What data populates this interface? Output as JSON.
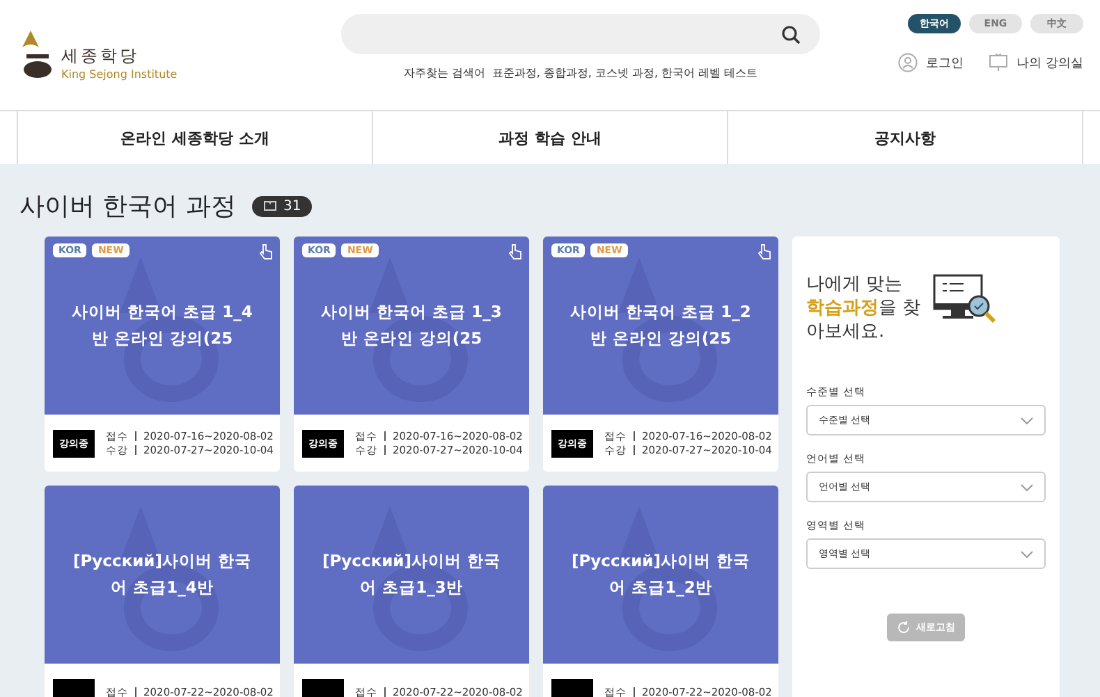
{
  "header": {
    "logo": {
      "korean": "세종학당",
      "english": "King Sejong Institute"
    },
    "popular": {
      "label": "자주찾는 검색어",
      "items": "표준과정, 종합과정, 코스넷 과정, 한국어 레벨 테스트"
    },
    "languages": [
      {
        "label": "한국어",
        "selected": true
      },
      {
        "label": "ENG",
        "selected": false
      },
      {
        "label": "中文",
        "selected": false
      }
    ],
    "user_links": [
      {
        "kind": "person",
        "label": "로그인"
      },
      {
        "kind": "board",
        "label": "나의 강의실"
      }
    ]
  },
  "nav": [
    "온라인 세종학당 소개",
    "과정 학습 안내",
    "공지사항"
  ],
  "section": {
    "title": "사이버 한국어 과정",
    "count": "31"
  },
  "courses": [
    {
      "tags": [
        {
          "kind": "lang",
          "label": "KOR"
        },
        {
          "kind": "new",
          "label": "NEW"
        }
      ],
      "pointer": true,
      "title": "사이버 한국어 초급 1_4반 온라인 강의(25",
      "status": "강의중",
      "dates": [
        {
          "label": "접수",
          "value": "2020-07-16~2020-08-02"
        },
        {
          "label": "수강",
          "value": "2020-07-27~2020-10-04"
        }
      ]
    },
    {
      "tags": [
        {
          "kind": "lang",
          "label": "KOR"
        },
        {
          "kind": "new",
          "label": "NEW"
        }
      ],
      "pointer": true,
      "title": "사이버 한국어 초급 1_3반 온라인 강의(25",
      "status": "강의중",
      "dates": [
        {
          "label": "접수",
          "value": "2020-07-16~2020-08-02"
        },
        {
          "label": "수강",
          "value": "2020-07-27~2020-10-04"
        }
      ]
    },
    {
      "tags": [
        {
          "kind": "lang",
          "label": "KOR"
        },
        {
          "kind": "new",
          "label": "NEW"
        }
      ],
      "pointer": true,
      "title": "사이버 한국어 초급 1_2반 온라인 강의(25",
      "status": "강의중",
      "dates": [
        {
          "label": "접수",
          "value": "2020-07-16~2020-08-02"
        },
        {
          "label": "수강",
          "value": "2020-07-27~2020-10-04"
        }
      ]
    },
    {
      "pointer": false,
      "title": "[Русский]사이버 한국어 초급1_4반",
      "dates": [
        {
          "label": "접수",
          "value": "2020-07-22~2020-08-02"
        }
      ]
    },
    {
      "pointer": false,
      "title": "[Русский]사이버 한국어 초급1_3반",
      "dates": [
        {
          "label": "접수",
          "value": "2020-07-22~2020-08-02"
        }
      ]
    },
    {
      "pointer": false,
      "title": "[Русский]사이버 한국어 초급1_2반",
      "dates": [
        {
          "label": "접수",
          "value": "2020-07-22~2020-08-02"
        }
      ]
    }
  ],
  "finder": {
    "heading": "나에게 맞는 **학습과정**을 찾아보세요.",
    "filters": [
      {
        "label": "수준별 선택",
        "value": "수준별 선택"
      },
      {
        "label": "언어별 선택",
        "value": "언어별 선택"
      },
      {
        "label": "영역별 선택",
        "value": "영역별 선택"
      }
    ],
    "reset": {
      "label": "새로고침",
      "disabled": true
    }
  }
}
